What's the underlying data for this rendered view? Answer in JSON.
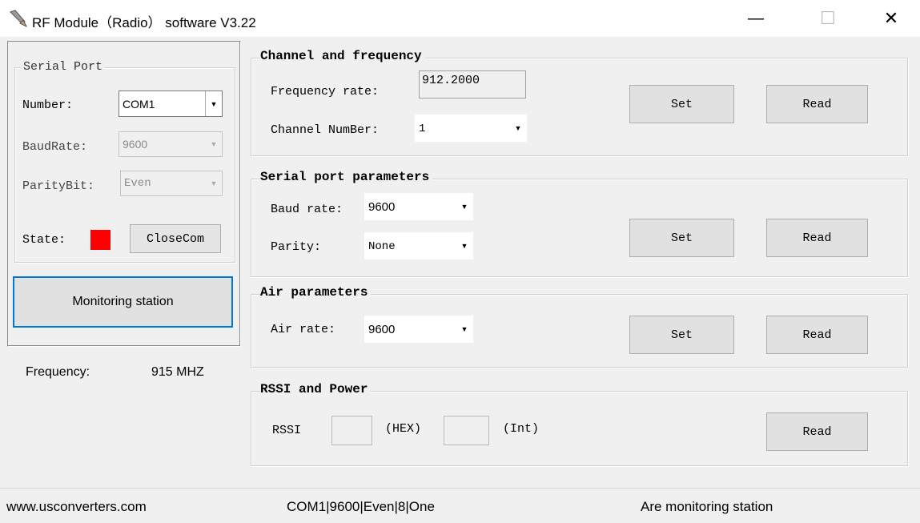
{
  "window": {
    "title": "RF Module（Radio） software V3.22",
    "minimize_glyph": "—",
    "maximize_glyph": "☐",
    "close_glyph": "✕"
  },
  "serial_port": {
    "group_title": "Serial Port",
    "number_label": "Number:",
    "number_value": "COM1",
    "baudrate_label": "BaudRate:",
    "baudrate_value": "9600",
    "paritybit_label": "ParityBit:",
    "paritybit_value": "Even",
    "state_label": "State:",
    "state_color": "#ff0000",
    "close_button": "CloseCom"
  },
  "monitoring_button": "Monitoring station",
  "frequency": {
    "label": "Frequency:",
    "value": "915 MHZ"
  },
  "channel": {
    "title": "Channel and frequency",
    "frequency_label": "Frequency rate:",
    "frequency_value": "912.2000",
    "channel_label": "Channel NumBer:",
    "channel_value": "1",
    "set": "Set",
    "read": "Read"
  },
  "serial_params": {
    "title": "Serial port parameters",
    "baud_label": "Baud rate:",
    "baud_value": "9600",
    "parity_label": "Parity:",
    "parity_value": "None",
    "set": "Set",
    "read": "Read"
  },
  "air": {
    "title": "Air parameters",
    "rate_label": "Air rate:",
    "rate_value": "9600",
    "set": "Set",
    "read": "Read"
  },
  "rssi": {
    "title": "RSSI and Power",
    "rssi_label": "RSSI",
    "hex_label": "(HEX)",
    "int_label": "(Int)",
    "hex_value": "",
    "int_value": "",
    "read": "Read"
  },
  "status": {
    "website": "www.usconverters.com",
    "port_info": "COM1|9600|Even|8|One",
    "state": "Are monitoring station"
  }
}
